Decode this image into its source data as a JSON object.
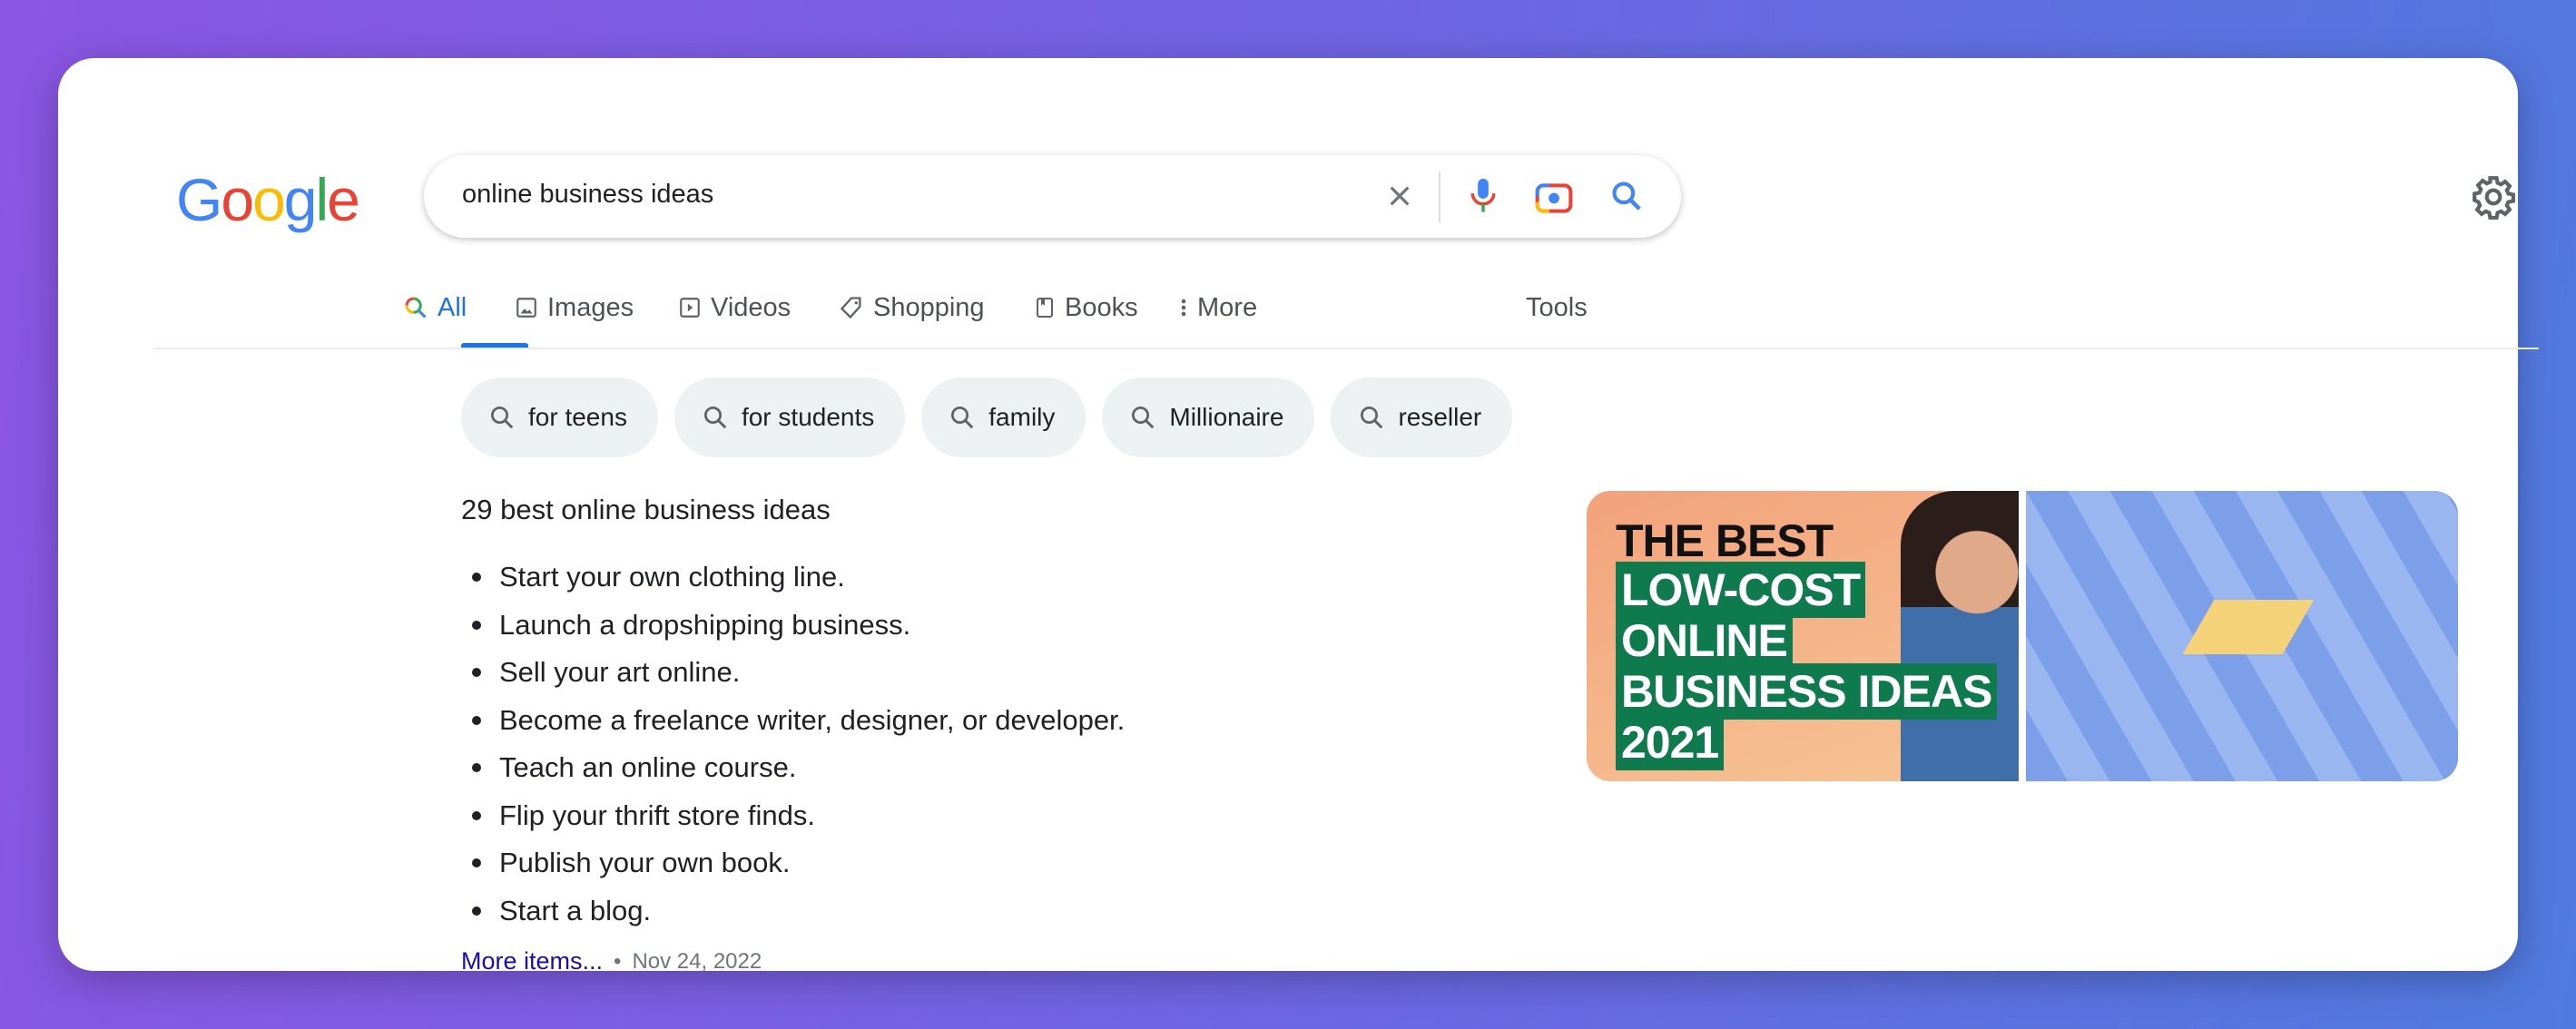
{
  "logo": {
    "letters": [
      "G",
      "o",
      "o",
      "g",
      "l",
      "e"
    ],
    "colors": [
      "#4285f4",
      "#ea4335",
      "#fbbc05",
      "#4285f4",
      "#34a853",
      "#ea4335"
    ]
  },
  "search": {
    "query": "online business ideas",
    "icons": [
      "close-icon",
      "mic-icon",
      "lens-camera-icon",
      "search-icon"
    ]
  },
  "settings_icon": "gear-icon",
  "tabs": [
    {
      "label": "All",
      "icon": "search-icon",
      "active": true
    },
    {
      "label": "Images",
      "icon": "image-icon"
    },
    {
      "label": "Videos",
      "icon": "play-icon"
    },
    {
      "label": "Shopping",
      "icon": "tag-icon"
    },
    {
      "label": "Books",
      "icon": "book-icon"
    },
    {
      "label": "More",
      "icon": "kebab-icon"
    }
  ],
  "tools_label": "Tools",
  "chips": [
    "for teens",
    "for students",
    "family",
    "Millionaire",
    "reseller"
  ],
  "snippet": {
    "heading": "29 best online business ideas",
    "items": [
      "Start your own clothing line.",
      "Launch a dropshipping business.",
      "Sell your art online.",
      "Become a freelance writer, designer, or developer.",
      "Teach an online course.",
      "Flip your thrift store finds.",
      "Publish your own book.",
      "Start a blog."
    ],
    "more_link": "More items...",
    "date": "Nov 24, 2022"
  },
  "images": {
    "image1_text": [
      "THE BEST",
      "LOW-COST",
      "ONLINE",
      "BUSINESS IDEAS",
      "2021"
    ]
  },
  "colors": {
    "accent": "#1a73e8",
    "link": "#1a0dab",
    "chip_bg": "#eef1f1"
  }
}
